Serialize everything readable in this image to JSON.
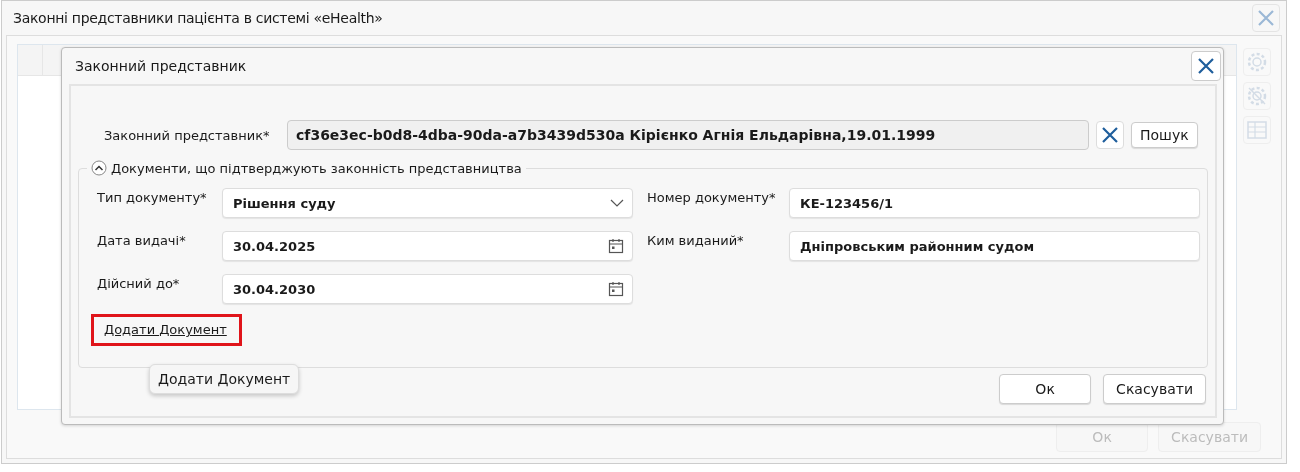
{
  "window": {
    "title": "Законні представники пацієнта в системі «eHealth»"
  },
  "buttons": [
    {
      "label": "Ок",
      "disabled": true
    },
    {
      "label": "Скасувати",
      "disabled": true
    }
  ],
  "dialog": {
    "title": "Законний представник",
    "representative": {
      "label": "Законний представник*",
      "value": "cf36e3ec-b0d8-4dba-90da-a7b3439d530a Кірієнко Агнія Ельдарівна,19.01.1999",
      "search_button": "Пошук"
    },
    "documents": {
      "legend": "Документи, що підтверджують законність представництва",
      "expanded": true,
      "rows": [
        [
          {
            "kind": "select",
            "label": "Тип документу*",
            "value": "Рішення суду"
          },
          {
            "kind": "text",
            "label": "Номер документу*",
            "value": "КЕ-123456/1"
          }
        ],
        [
          {
            "kind": "date",
            "label": "Дата видачі*",
            "value": "30.04.2025"
          },
          {
            "kind": "text",
            "label": "Ким виданий*",
            "value": "Дніпровським районним судом"
          }
        ],
        [
          {
            "kind": "date",
            "label": "Дійсний до*",
            "value": "30.04.2030"
          }
        ]
      ],
      "add_link": {
        "label": "Додати Документ",
        "highlighted": true
      }
    },
    "tooltip": "Додати Документ",
    "buttons": [
      {
        "label": "Ок",
        "disabled": false
      },
      {
        "label": "Скасувати",
        "disabled": false
      }
    ]
  }
}
